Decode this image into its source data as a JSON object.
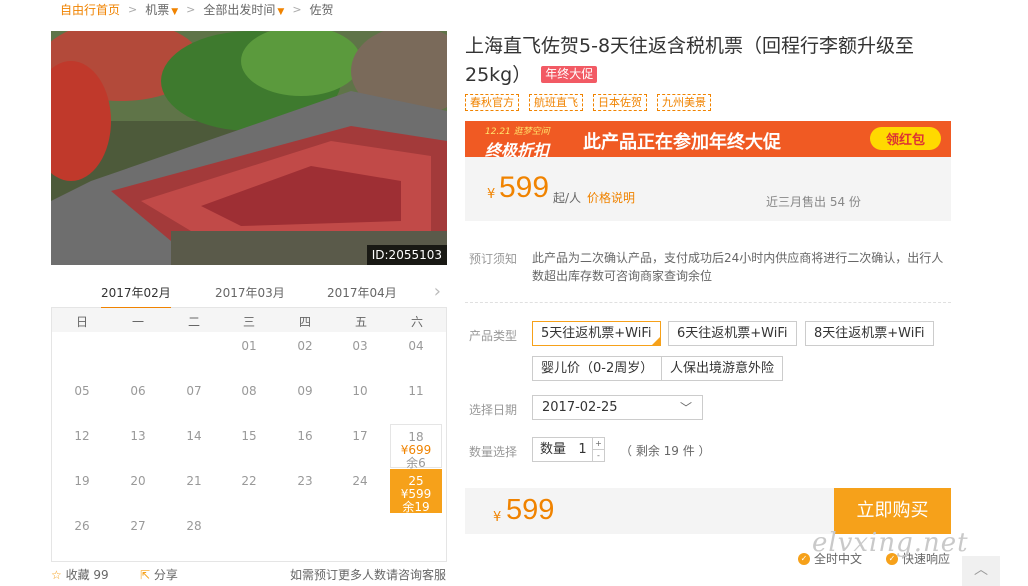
{
  "breadcrumb": {
    "home": "自由行首页",
    "item1": "机票",
    "item2": "全部出发时间",
    "item3": "佐贺"
  },
  "photo": {
    "id_label": "ID:2055103"
  },
  "calendar": {
    "months": [
      "2017年02月",
      "2017年03月",
      "2017年04月"
    ],
    "weekdays": [
      "日",
      "一",
      "二",
      "三",
      "四",
      "五",
      "六"
    ],
    "days": {
      "d01": "01",
      "d02": "02",
      "d03": "03",
      "d04": "04",
      "d05": "05",
      "d06": "06",
      "d07": "07",
      "d08": "08",
      "d09": "09",
      "d10": "10",
      "d11": "11",
      "d12": "12",
      "d13": "13",
      "d14": "14",
      "d15": "15",
      "d16": "16",
      "d17": "17",
      "d18": "18",
      "d18_price": "¥699",
      "d18_remain": "余6",
      "d19": "19",
      "d20": "20",
      "d21": "21",
      "d22": "22",
      "d23": "23",
      "d24": "24",
      "d25": "25",
      "d25_price": "¥599",
      "d25_remain": "余19",
      "d26": "26",
      "d27": "27",
      "d28": "28"
    }
  },
  "under_calendar": {
    "fav": "收藏 99",
    "share": "分享",
    "tip": "如需预订更多人数请咨询客服"
  },
  "product": {
    "title": "上海直飞佐贺5-8天往返含税机票（回程行李额升级至25kg）",
    "badge": "年终大促",
    "tags": [
      "春秋官方",
      "航班直飞",
      "日本佐贺",
      "九州美景"
    ]
  },
  "banner": {
    "small": "12.21 逛梦空间",
    "big": "终极折扣",
    "mid": "此产品正在参加年终大促",
    "cta": "领红包"
  },
  "price": {
    "currency": "¥",
    "value": "599",
    "unit": "起/人",
    "link": "价格说明",
    "sold": "近三月售出 54 份"
  },
  "notice": {
    "label": "预订须知",
    "text": "此产品为二次确认产品，支付成功后24小时内供应商将进行二次确认，出行人数超出库存数可咨询商家查询余位"
  },
  "options": {
    "label": "产品类型",
    "items": [
      "5天往返机票+WiFi",
      "6天往返机票+WiFi",
      "8天往返机票+WiFi",
      "婴儿价（0-2周岁）",
      "人保出境游意外险"
    ]
  },
  "date_select": {
    "label": "选择日期",
    "value": "2017-02-25"
  },
  "quantity": {
    "label": "数量选择",
    "field_label": "数量",
    "value": "1",
    "remain": "（ 剩余 19 件 ）"
  },
  "buy": {
    "currency": "¥",
    "value": "599",
    "button": "立即购买"
  },
  "services": {
    "s1": "全时中文",
    "s2": "快速响应"
  },
  "watermark": "elvxing.net"
}
